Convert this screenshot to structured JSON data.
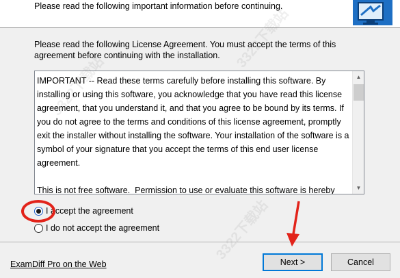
{
  "header": {
    "subtitle": "Please read the following important information before continuing.",
    "icon": "computer-monitor-icon"
  },
  "intro": {
    "text": "Please read the following License Agreement. You must accept the terms of this agreement before continuing with the installation."
  },
  "license": {
    "text": "IMPORTANT -- Read these terms carefully before installing this software. By installing or using this software, you acknowledge that you have read this license agreement, that you understand it, and that you agree to be bound by its terms. If you do not agree to the terms and conditions of this license agreement, promptly exit the installer without installing the software. Your installation of the software is a symbol of your signature that you accept the terms of this end user license agreement.\n\nThis is not free software.  Permission to use or evaluate this software is hereby"
  },
  "options": {
    "accept_label": "I accept the agreement",
    "decline_label": "I do not accept the agreement",
    "selected": "accept"
  },
  "footer": {
    "link_label": "ExamDiff Pro on the Web",
    "next_label": "Next >",
    "cancel_label": "Cancel"
  },
  "annotations": {
    "highlight_color": "#e2231a"
  },
  "watermark": {
    "text": "3322下载站"
  }
}
